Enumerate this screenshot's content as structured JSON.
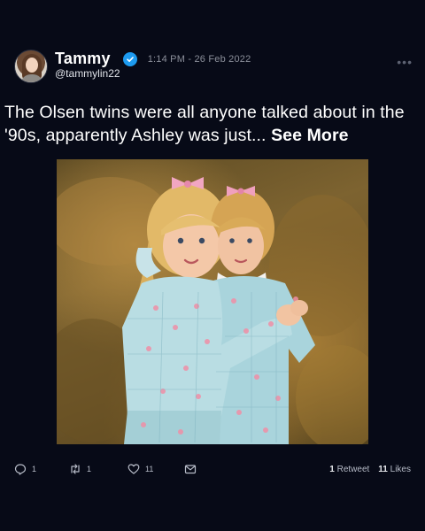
{
  "tweet": {
    "user_name": "Tammy",
    "handle": "@tammylin22",
    "timestamp": "1:14 PM - 26 Feb 2022",
    "more_label": "•••",
    "text": "The Olsen twins were all anyone talked about in the '90s, apparently Ashley was just...",
    "see_more_label": "See More",
    "verified_color": "#1d9bf0",
    "avatar_icon": "user-avatar",
    "image_icon": "photo-of-twin-girls"
  },
  "actions": {
    "reply_icon": "reply-icon",
    "reply_count": "1",
    "retweet_icon": "retweet-icon",
    "retweet_count": "1",
    "like_icon": "heart-icon",
    "like_count": "11",
    "share_icon": "share-icon"
  },
  "stats": {
    "retweets_value": "1",
    "retweets_label": "Retweet",
    "likes_value": "11",
    "likes_label": "Likes"
  }
}
